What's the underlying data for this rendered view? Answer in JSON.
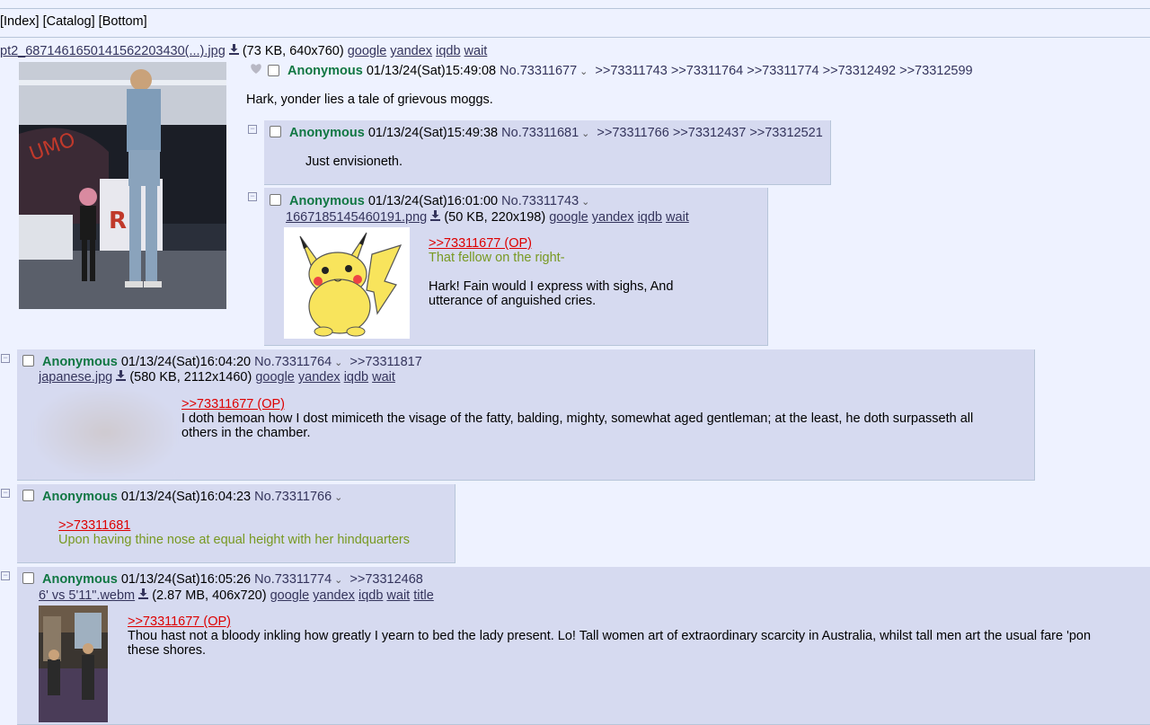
{
  "nav": {
    "index": "Index",
    "catalog": "Catalog",
    "bottom": "Bottom"
  },
  "op": {
    "file": {
      "name": "pt2_6871461650141562203430(...).jpg",
      "info": "(73 KB, 640x760)"
    },
    "search": [
      "google",
      "yandex",
      "iqdb",
      "wait"
    ],
    "name": "Anonymous",
    "date": "01/13/24(Sat)15:49:08",
    "no": "No.73311677",
    "backlinks": [
      ">>73311743",
      ">>73311764",
      ">>73311774",
      ">>73312492",
      ">>73312599"
    ],
    "message": "Hark, yonder lies a tale of grievous moggs."
  },
  "r1": {
    "name": "Anonymous",
    "date": "01/13/24(Sat)15:49:38",
    "no": "No.73311681",
    "backlinks": [
      ">>73311766",
      ">>73312437",
      ">>73312521"
    ],
    "message": "Just envisioneth."
  },
  "r2": {
    "name": "Anonymous",
    "date": "01/13/24(Sat)16:01:00",
    "no": "No.73311743",
    "file": {
      "name": "1667185145460191.png",
      "info": "(50 KB, 220x198)"
    },
    "search": [
      "google",
      "yandex",
      "iqdb",
      "wait"
    ],
    "quote": ">>73311677 (OP)",
    "green": "That fellow on the right-",
    "line1": "Hark! Fain would I express with sighs, And",
    "line2": "utterance of anguished cries."
  },
  "r3": {
    "name": "Anonymous",
    "date": "01/13/24(Sat)16:04:20",
    "no": "No.73311764",
    "backlinks": [
      ">>73311817"
    ],
    "file": {
      "name": "japanese.jpg",
      "info": "(580 KB, 2112x1460)"
    },
    "search": [
      "google",
      "yandex",
      "iqdb",
      "wait"
    ],
    "quote": ">>73311677 (OP)",
    "line1": "I doth bemoan how I dost mimiceth the visage of the fatty, balding, mighty, somewhat aged gentleman; at the least, he doth surpasseth all",
    "line2": "others in the chamber."
  },
  "r4": {
    "name": "Anonymous",
    "date": "01/13/24(Sat)16:04:23",
    "no": "No.73311766",
    "quote": ">>73311681",
    "green": "Upon having thine nose at equal height with her hindquarters"
  },
  "r5": {
    "name": "Anonymous",
    "date": "01/13/24(Sat)16:05:26",
    "no": "No.73311774",
    "backlinks": [
      ">>73312468"
    ],
    "file": {
      "name": "6' vs 5'11\".webm",
      "info": "(2.87 MB, 406x720)"
    },
    "search": [
      "google",
      "yandex",
      "iqdb",
      "wait",
      "title"
    ],
    "quote": ">>73311677 (OP)",
    "line1": "Thou hast not a bloody inkling how greatly I yearn to bed the lady present. Lo! Tall women art of extraordinary scarcity in Australia, whilst tall men art the usual fare 'pon",
    "line2": "these shores."
  },
  "icons": {
    "download": "download-icon",
    "heart": "heart-icon",
    "chevron": "chevron-down-icon",
    "minus": "minus-box-icon"
  },
  "colors": {
    "name": "#117743",
    "quote": "#dd0000",
    "green": "#789922",
    "reply_bg": "#d6daf0",
    "page_bg": "#eef2ff",
    "link": "#34345c"
  }
}
